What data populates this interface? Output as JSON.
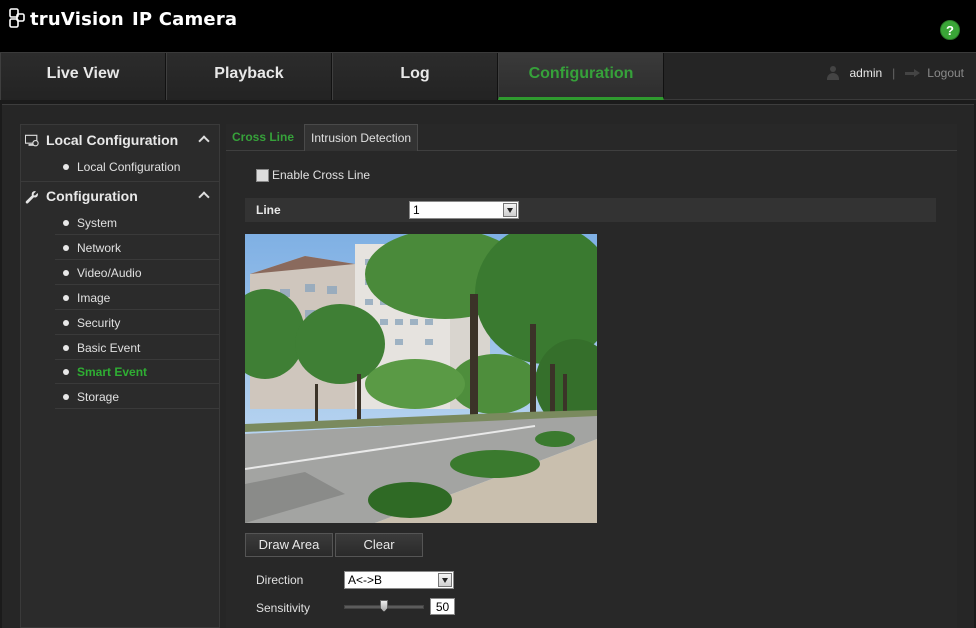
{
  "app": {
    "brand": "truVision",
    "product": "IP Camera",
    "help_icon": "help-icon",
    "accent_color": "#36a13a"
  },
  "nav": {
    "tabs": [
      {
        "label": "Live View"
      },
      {
        "label": "Playback"
      },
      {
        "label": "Log"
      },
      {
        "label": "Configuration",
        "active": true
      }
    ],
    "user": "admin",
    "separator": "|",
    "logout": "Logout"
  },
  "sidebar": {
    "groups": [
      {
        "label": "Local Configuration",
        "icon": "local-config-icon",
        "items": [
          {
            "label": "Local Configuration"
          }
        ]
      },
      {
        "label": "Configuration",
        "icon": "wrench-icon",
        "items": [
          {
            "label": "System"
          },
          {
            "label": "Network"
          },
          {
            "label": "Video/Audio"
          },
          {
            "label": "Image"
          },
          {
            "label": "Security"
          },
          {
            "label": "Basic Event"
          },
          {
            "label": "Smart Event",
            "active": true
          },
          {
            "label": "Storage"
          }
        ]
      }
    ]
  },
  "main": {
    "tabs": [
      {
        "label": "Cross Line",
        "active": true
      },
      {
        "label": "Intrusion Detection"
      }
    ],
    "enable_label": "Enable Cross Line",
    "enable_checked": false,
    "line_label": "Line",
    "line_value": "1",
    "buttons": {
      "draw_area": "Draw Area",
      "clear": "Clear"
    },
    "direction_label": "Direction",
    "direction_value": "A<->B",
    "sensitivity_label": "Sensitivity",
    "sensitivity_value": "50",
    "sensitivity_fraction": 0.5
  }
}
